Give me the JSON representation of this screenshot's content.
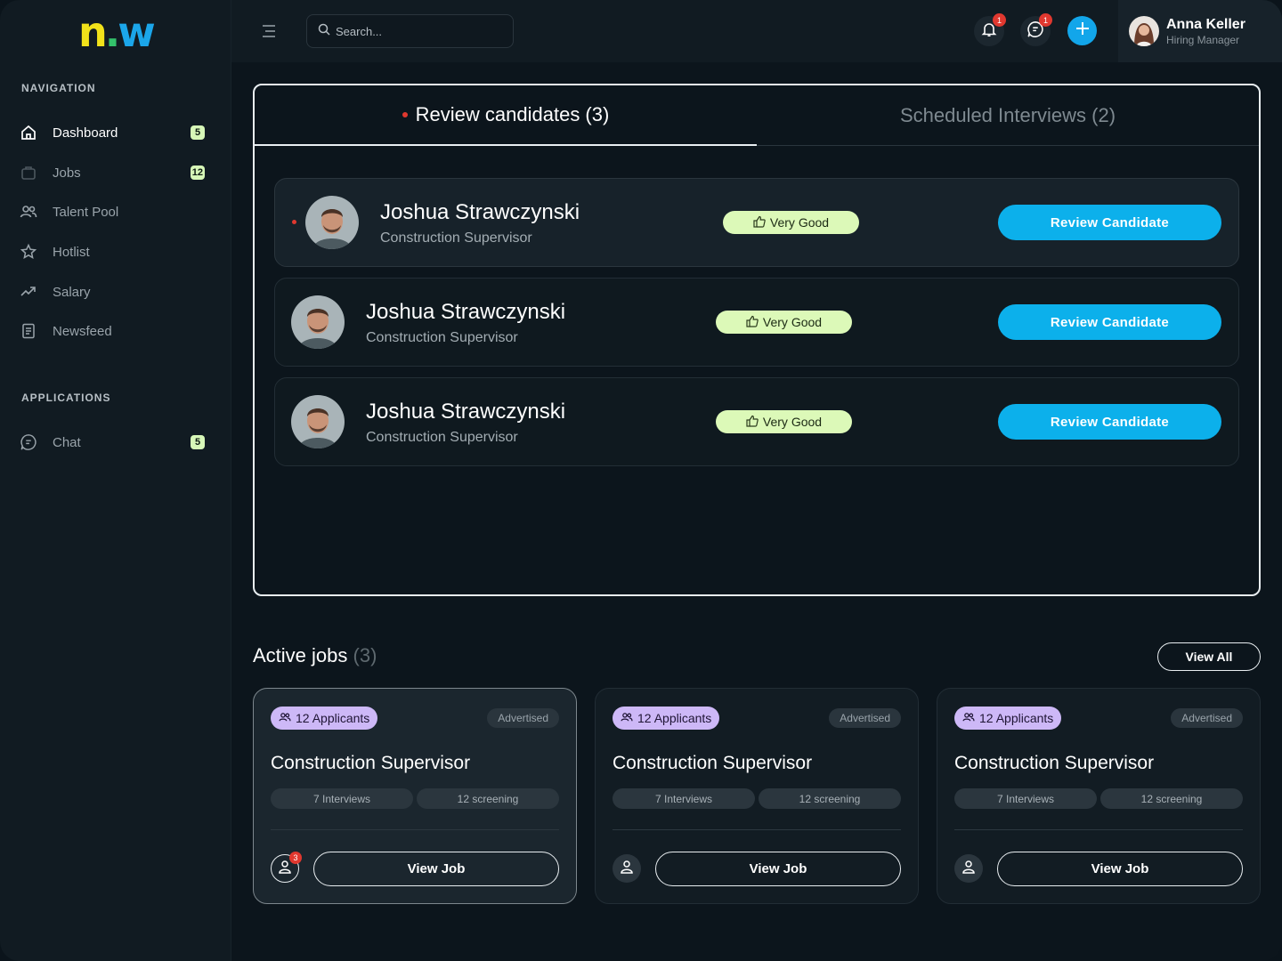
{
  "logo": {
    "n": "n",
    "dot": ".",
    "w": "w"
  },
  "sidebar": {
    "navigation_heading": "NAVIGATION",
    "applications_heading": "APPLICATIONS",
    "items": [
      {
        "label": "Dashboard",
        "badge": "5",
        "icon": "home-icon"
      },
      {
        "label": "Jobs",
        "badge": "12",
        "icon": "briefcase-icon"
      },
      {
        "label": "Talent Pool",
        "icon": "users-icon"
      },
      {
        "label": "Hotlist",
        "icon": "star-icon"
      },
      {
        "label": "Salary",
        "icon": "trending-up-icon"
      },
      {
        "label": "Newsfeed",
        "icon": "newspaper-icon"
      }
    ],
    "apps": [
      {
        "label": "Chat",
        "badge": "5",
        "icon": "chat-icon"
      }
    ]
  },
  "topbar": {
    "search_placeholder": "Search...",
    "notifications_count": "1",
    "messages_count": "1",
    "user": {
      "name": "Anna Keller",
      "role": "Hiring Manager"
    }
  },
  "review": {
    "tabs": [
      {
        "label": "Review candidates (3)"
      },
      {
        "label": "Scheduled Interviews (2)"
      }
    ],
    "candidates": [
      {
        "name": "Joshua Strawczynski",
        "role": "Construction Supervisor",
        "rating": "Very Good",
        "action": "Review Candidate"
      },
      {
        "name": "Joshua Strawczynski",
        "role": "Construction Supervisor",
        "rating": "Very Good",
        "action": "Review Candidate"
      },
      {
        "name": "Joshua Strawczynski",
        "role": "Construction Supervisor",
        "rating": "Very Good",
        "action": "Review Candidate"
      }
    ]
  },
  "active_jobs": {
    "title": "Active jobs",
    "count": "(3)",
    "view_all": "View All",
    "jobs": [
      {
        "applicants": "12 Applicants",
        "status": "Advertised",
        "title": "Construction Supervisor",
        "interviews": "7 Interviews",
        "screening": "12 screening",
        "alerts": "3",
        "action": "View Job"
      },
      {
        "applicants": "12 Applicants",
        "status": "Advertised",
        "title": "Construction Supervisor",
        "interviews": "7 Interviews",
        "screening": "12 screening",
        "action": "View Job"
      },
      {
        "applicants": "12 Applicants",
        "status": "Advertised",
        "title": "Construction Supervisor",
        "interviews": "7 Interviews",
        "screening": "12 screening",
        "action": "View Job"
      }
    ]
  },
  "colors": {
    "accent_blue": "#0cb0eb",
    "rating_green": "#dcf9b8",
    "applicants_purple": "#cdb8f7",
    "alert_red": "#e0382f",
    "badge_green": "#d7f7b8"
  }
}
